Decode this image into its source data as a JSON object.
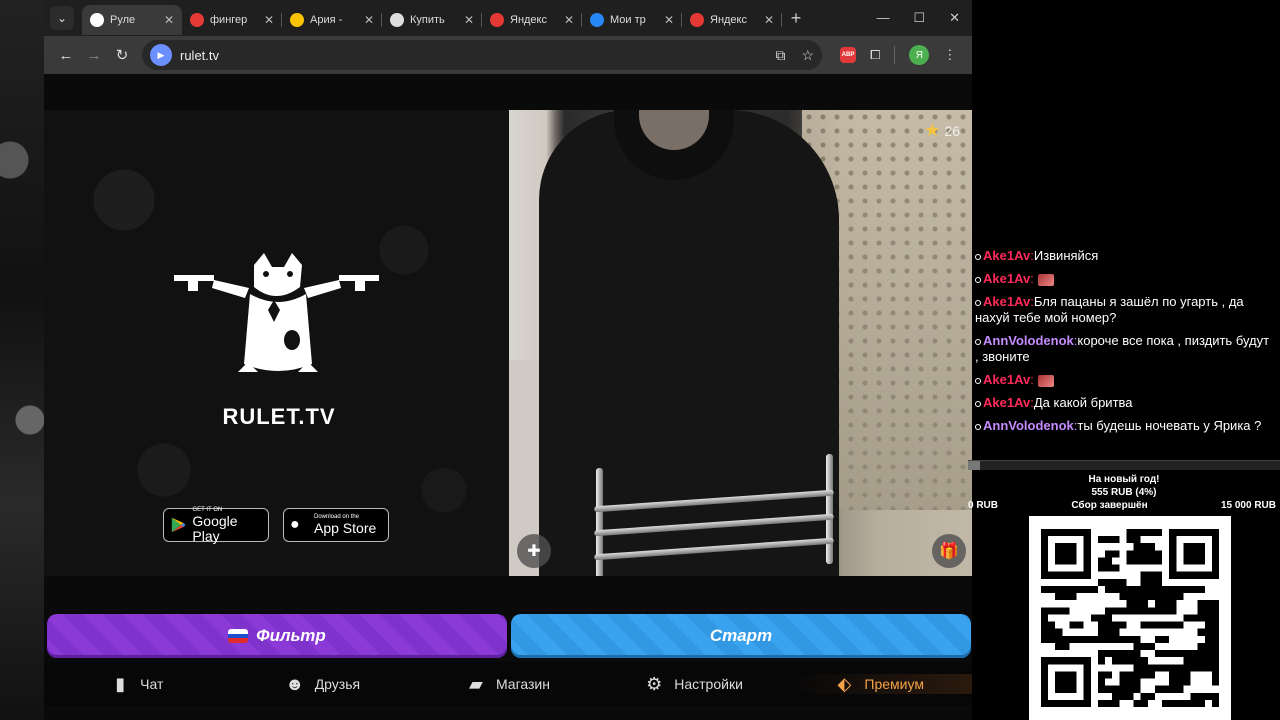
{
  "browser": {
    "tabs": [
      {
        "label": "Руле",
        "active": true,
        "favicon_color": "#ffffff"
      },
      {
        "label": "фингер",
        "active": false,
        "favicon_color": "#e53935"
      },
      {
        "label": "Ария - ",
        "active": false,
        "favicon_color": "#f9c300"
      },
      {
        "label": "Купить",
        "active": false,
        "favicon_color": "#dddddd"
      },
      {
        "label": "Яндекс",
        "active": false,
        "favicon_color": "#e53935"
      },
      {
        "label": "Мои тр",
        "active": false,
        "favicon_color": "#2787f5"
      },
      {
        "label": "Яндекс",
        "active": false,
        "favicon_color": "#e53935"
      }
    ],
    "new_tab_label": "+",
    "url": "rulet.tv",
    "profile_initial": "Я",
    "abp_label": "ABP"
  },
  "promo": {
    "logo_text": "RULET.TV",
    "google_play": {
      "small": "GET IT ON",
      "big": "Google Play"
    },
    "app_store": {
      "small": "Download on the",
      "big": "App Store"
    }
  },
  "video": {
    "star_count": "26"
  },
  "actions": {
    "filter_label": "Фильтр",
    "start_label": "Старт"
  },
  "bottom_nav": [
    {
      "label": "Чат",
      "icon": "chat-icon"
    },
    {
      "label": "Друзья",
      "icon": "friends-icon"
    },
    {
      "label": "Магазин",
      "icon": "shop-bag-icon"
    },
    {
      "label": "Настройки",
      "icon": "gear-icon"
    },
    {
      "label": "Премиум",
      "icon": "premium-tag-icon"
    }
  ],
  "chat": {
    "messages": [
      {
        "user": "Ake1Av",
        "color": "#ff2a5a",
        "text": "Извиняйся",
        "emote": false
      },
      {
        "user": "Ake1Av",
        "color": "#ff2a5a",
        "text": "",
        "emote": true
      },
      {
        "user": "Ake1Av",
        "color": "#ff2a5a",
        "text": "Бля пацаны я зашёл по угарть , да нахуй тебе мой номер?",
        "emote": false
      },
      {
        "user": "AnnVolodenok",
        "color": "#c58cff",
        "text": "короче все пока , пиздить будут , звоните",
        "emote": false
      },
      {
        "user": "Ake1Av",
        "color": "#ff2a5a",
        "text": "",
        "emote": true
      },
      {
        "user": "Ake1Av",
        "color": "#ff2a5a",
        "text": "Да какой бритва",
        "emote": false
      },
      {
        "user": "AnnVolodenok",
        "color": "#c58cff",
        "text": "ты будешь ночевать у Ярика ?",
        "emote": false
      }
    ]
  },
  "donation": {
    "title": "На новый год!",
    "amount": "555 RUB (4%)",
    "min": "0 RUB",
    "status": "Сбор завершён",
    "max": "15 000 RUB",
    "progress": 0.04
  }
}
